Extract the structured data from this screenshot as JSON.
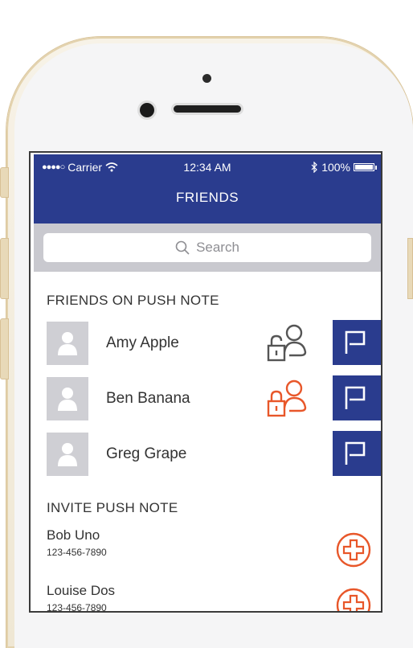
{
  "status": {
    "carrier": "Carrier",
    "time": "12:34 AM",
    "battery": "100%"
  },
  "nav": {
    "title": "FRIENDS"
  },
  "search": {
    "placeholder": "Search"
  },
  "friends_section": {
    "title": "FRIENDS ON PUSH NOTE",
    "items": [
      {
        "name": "Amy Apple",
        "lock_color": "#555555"
      },
      {
        "name": "Ben Banana",
        "lock_color": "#e8572a"
      },
      {
        "name": "Greg Grape",
        "lock_color": ""
      }
    ]
  },
  "invite_section": {
    "title": "INVITE PUSH NOTE",
    "items": [
      {
        "name": "Bob Uno",
        "phone": "123-456-7890"
      },
      {
        "name": "Louise Dos",
        "phone": "123-456-7890"
      }
    ]
  },
  "colors": {
    "brand": "#2a3c8e",
    "accent": "#e8572a"
  }
}
